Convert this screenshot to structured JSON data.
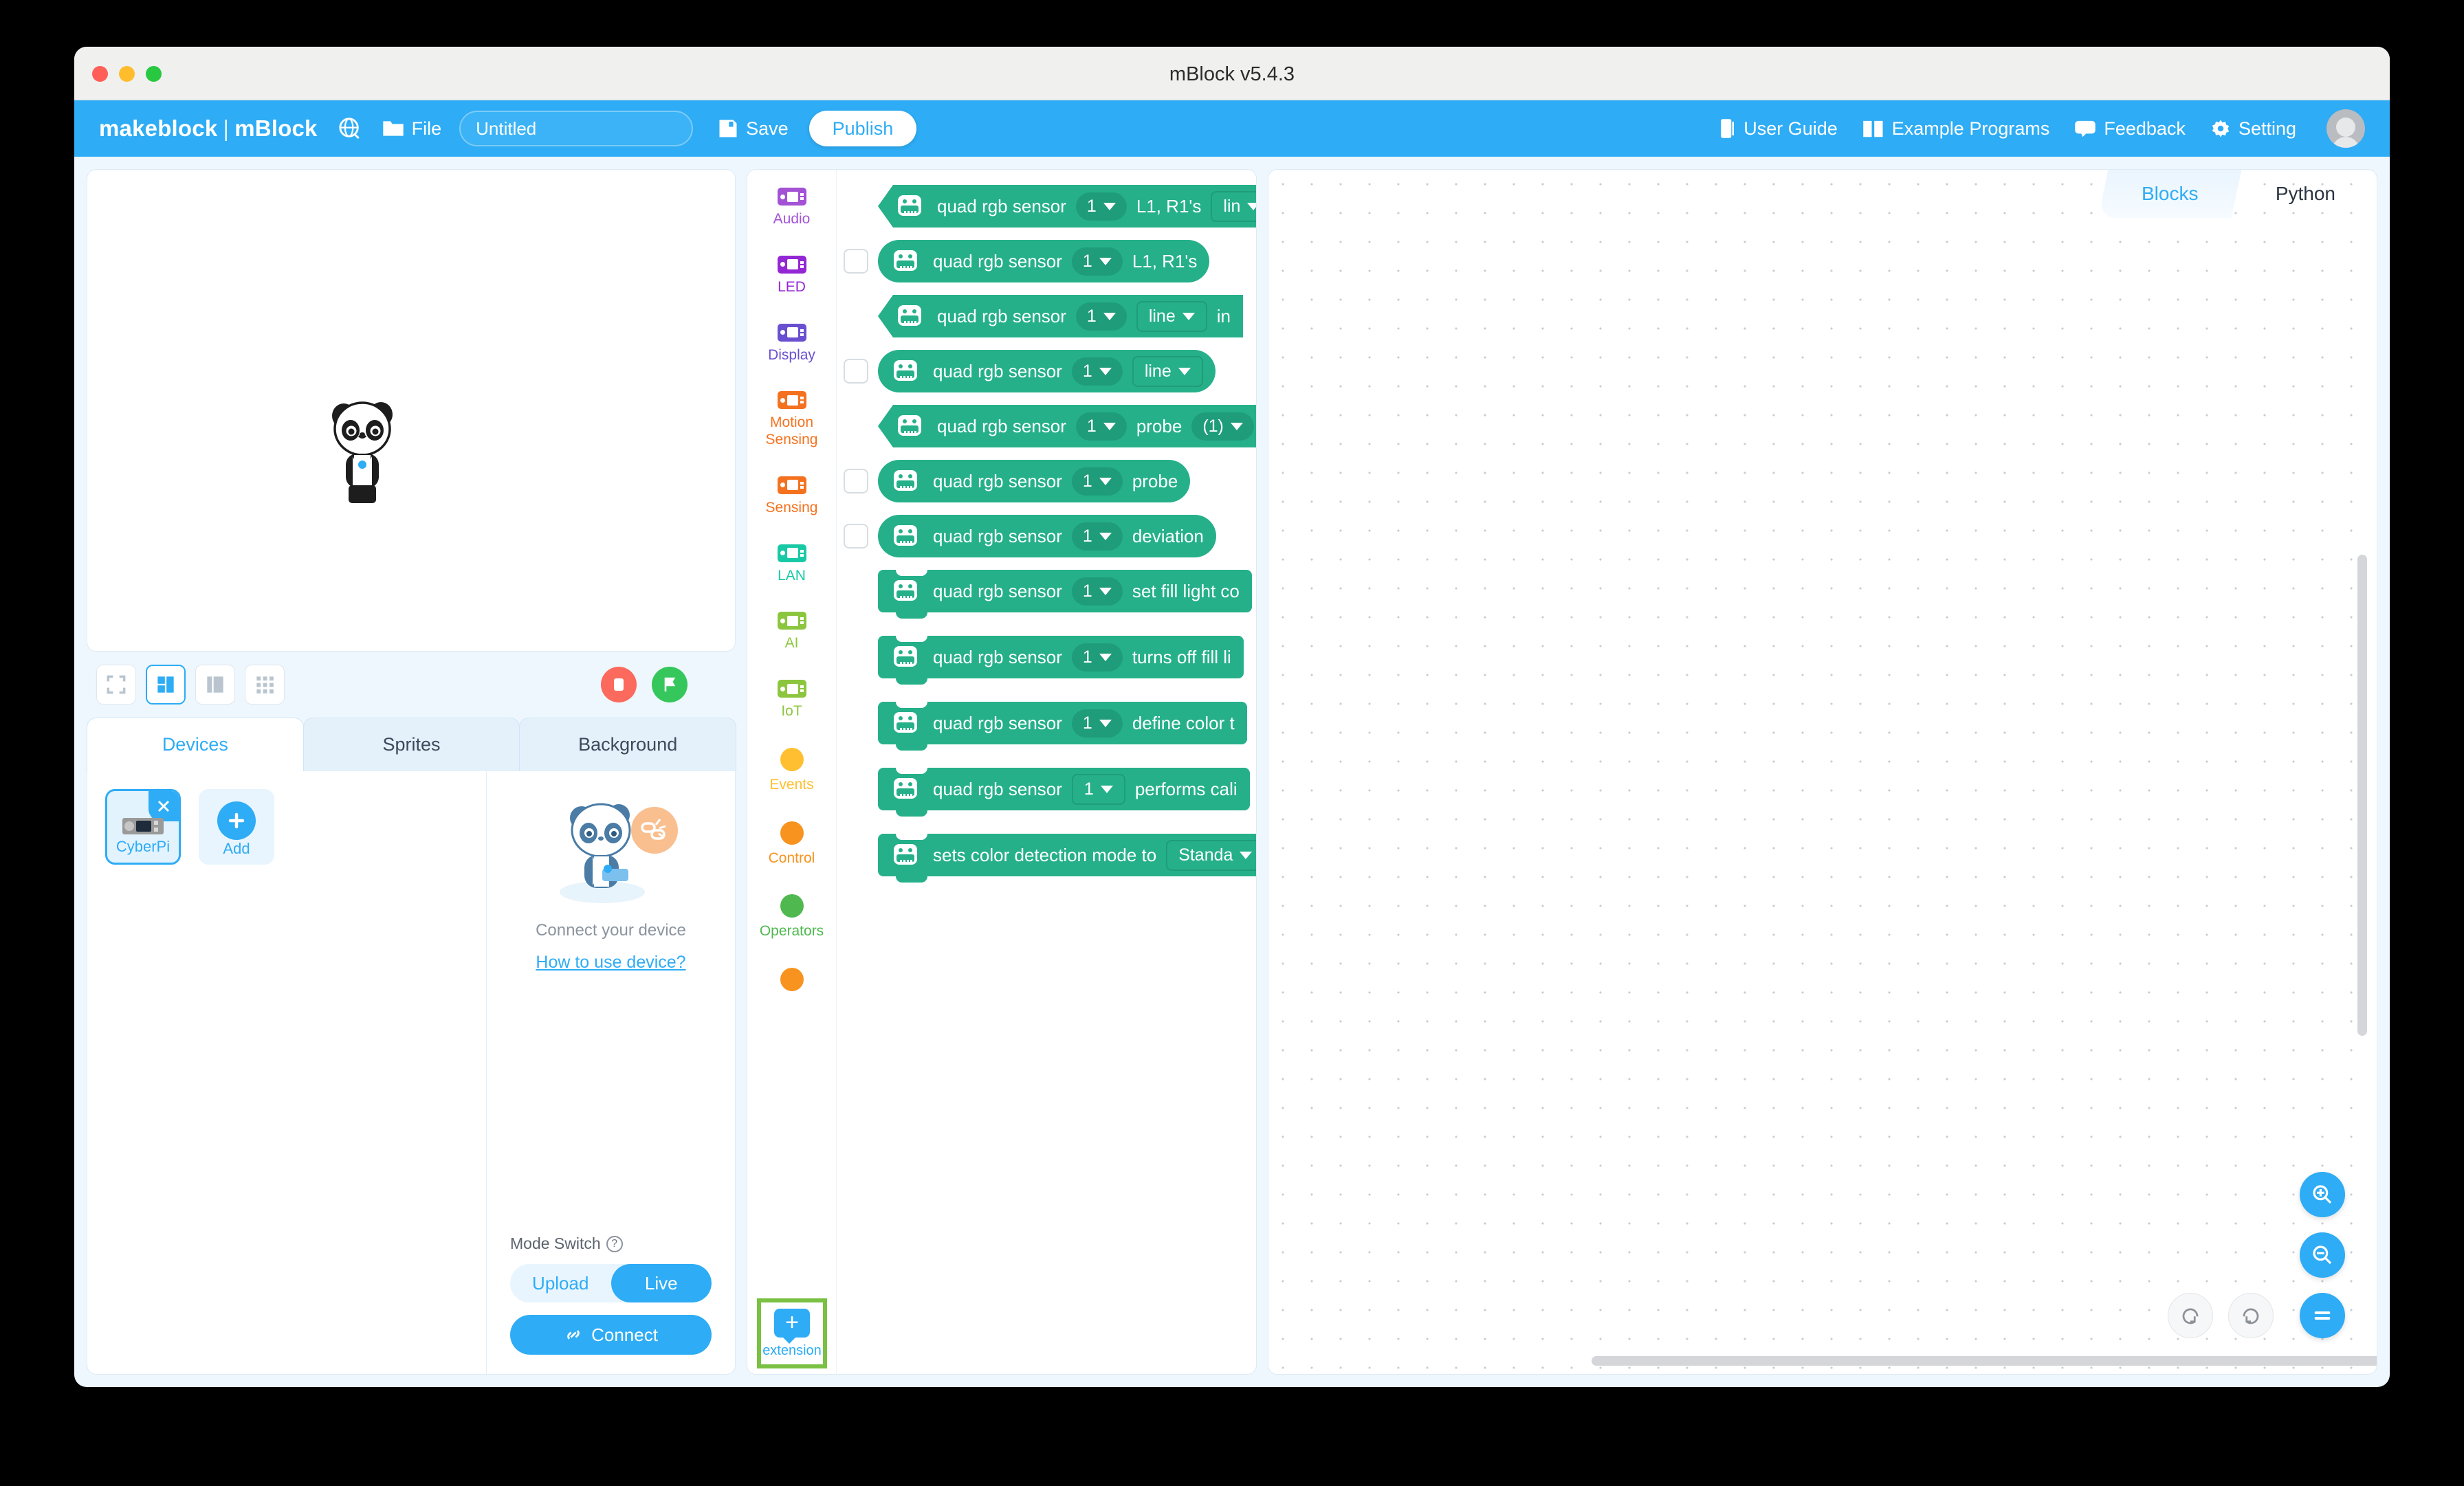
{
  "window": {
    "title": "mBlock v5.4.3"
  },
  "toolbar": {
    "brand_make": "makeblock",
    "brand_sep": "|",
    "brand_mblock": "mBlock",
    "globe_icon": "globe-icon",
    "file_label": "File",
    "project_name": "Untitled",
    "project_placeholder": "Untitled",
    "save_label": "Save",
    "publish_label": "Publish",
    "right_items": [
      {
        "label": "User Guide",
        "icon": "book-icon"
      },
      {
        "label": "Example Programs",
        "icon": "open-book-icon"
      },
      {
        "label": "Feedback",
        "icon": "chat-icon"
      },
      {
        "label": "Setting",
        "icon": "gear-icon"
      }
    ]
  },
  "stage": {
    "view_buttons": [
      "fullscreen-view",
      "small-stage-view",
      "large-stage-view",
      "grid-view"
    ],
    "selected_view": "small-stage-view",
    "stop_label": "stop-button",
    "go_label": "green-flag-button"
  },
  "tabs": [
    {
      "label": "Devices",
      "active": true
    },
    {
      "label": "Sprites",
      "active": false
    },
    {
      "label": "Background",
      "active": false
    }
  ],
  "devices": {
    "items": [
      {
        "label": "CyberPi",
        "selected": true
      },
      {
        "label": "Add",
        "selected": false
      }
    ],
    "close_glyph": "✕",
    "add_glyph": "+"
  },
  "connect": {
    "message": "Connect your device",
    "link": "How to use device?",
    "mode_label": "Mode Switch",
    "help_glyph": "?",
    "modes": [
      "Upload",
      "Live"
    ],
    "active_mode": "Live",
    "connect_label": "Connect",
    "connect_icon": "link-icon"
  },
  "palette": {
    "categories": [
      {
        "label": "Audio",
        "color": "#a352d6",
        "shape": "chip"
      },
      {
        "label": "LED",
        "color": "#9327d4",
        "shape": "chip"
      },
      {
        "label": "Display",
        "color": "#6a4fd0",
        "shape": "chip"
      },
      {
        "label": "Motion\nSensing",
        "color": "#f4721f",
        "shape": "chip"
      },
      {
        "label": "Sensing",
        "color": "#f4721f",
        "shape": "chip"
      },
      {
        "label": "LAN",
        "color": "#19c9a6",
        "shape": "chip"
      },
      {
        "label": "AI",
        "color": "#8cc63e",
        "shape": "chip"
      },
      {
        "label": "IoT",
        "color": "#8cc63e",
        "shape": "chip"
      },
      {
        "label": "Events",
        "color": "#ffbf30",
        "shape": "ball"
      },
      {
        "label": "Control",
        "color": "#f7931e",
        "shape": "ball"
      },
      {
        "label": "Operators",
        "color": "#4fb94f",
        "shape": "ball"
      },
      {
        "label": "",
        "color": "#f7931e",
        "shape": "ball"
      }
    ],
    "extension": {
      "label": "extension",
      "glyph": "+",
      "highlight_color": "#7ac143"
    },
    "blocks": [
      {
        "kind": "bool",
        "checkbox": false,
        "icon": "quad-rgb-sensor-icon",
        "parts": [
          {
            "t": "text",
            "v": "quad rgb sensor"
          },
          {
            "t": "dd",
            "v": "1"
          },
          {
            "t": "text",
            "v": "L1, R1's"
          },
          {
            "t": "ddsq",
            "v": "lin"
          }
        ]
      },
      {
        "kind": "round",
        "checkbox": true,
        "icon": "quad-rgb-sensor-icon",
        "parts": [
          {
            "t": "text",
            "v": "quad rgb sensor"
          },
          {
            "t": "dd",
            "v": "1"
          },
          {
            "t": "text",
            "v": "L1, R1's"
          }
        ]
      },
      {
        "kind": "bool",
        "checkbox": false,
        "icon": "quad-rgb-sensor-icon",
        "parts": [
          {
            "t": "text",
            "v": "quad rgb sensor"
          },
          {
            "t": "dd",
            "v": "1"
          },
          {
            "t": "ddsq",
            "v": "line"
          },
          {
            "t": "text",
            "v": "in"
          }
        ]
      },
      {
        "kind": "round",
        "checkbox": true,
        "icon": "quad-rgb-sensor-icon",
        "parts": [
          {
            "t": "text",
            "v": "quad rgb sensor"
          },
          {
            "t": "dd",
            "v": "1"
          },
          {
            "t": "ddsq",
            "v": "line"
          }
        ]
      },
      {
        "kind": "bool",
        "checkbox": false,
        "icon": "quad-rgb-sensor-icon",
        "parts": [
          {
            "t": "text",
            "v": "quad rgb sensor"
          },
          {
            "t": "dd",
            "v": "1"
          },
          {
            "t": "text",
            "v": "probe"
          },
          {
            "t": "dd",
            "v": "(1)"
          }
        ]
      },
      {
        "kind": "round",
        "checkbox": true,
        "icon": "quad-rgb-sensor-icon",
        "parts": [
          {
            "t": "text",
            "v": "quad rgb sensor"
          },
          {
            "t": "dd",
            "v": "1"
          },
          {
            "t": "text",
            "v": "probe"
          }
        ]
      },
      {
        "kind": "round",
        "checkbox": true,
        "icon": "quad-rgb-sensor-icon",
        "parts": [
          {
            "t": "text",
            "v": "quad rgb sensor"
          },
          {
            "t": "dd",
            "v": "1"
          },
          {
            "t": "text",
            "v": "deviation"
          }
        ]
      },
      {
        "kind": "stack",
        "checkbox": false,
        "icon": "quad-rgb-sensor-icon",
        "parts": [
          {
            "t": "text",
            "v": "quad rgb sensor"
          },
          {
            "t": "dd",
            "v": "1"
          },
          {
            "t": "text",
            "v": "set fill light co"
          }
        ]
      },
      {
        "kind": "stack",
        "checkbox": false,
        "icon": "quad-rgb-sensor-icon",
        "parts": [
          {
            "t": "text",
            "v": "quad rgb sensor"
          },
          {
            "t": "dd",
            "v": "1"
          },
          {
            "t": "text",
            "v": "turns off fill li"
          }
        ]
      },
      {
        "kind": "stack",
        "checkbox": false,
        "icon": "quad-rgb-sensor-icon",
        "parts": [
          {
            "t": "text",
            "v": "quad rgb sensor"
          },
          {
            "t": "dd",
            "v": "1"
          },
          {
            "t": "text",
            "v": "define color t"
          }
        ]
      },
      {
        "kind": "stack",
        "checkbox": false,
        "icon": "quad-rgb-sensor-icon",
        "parts": [
          {
            "t": "text",
            "v": "quad rgb sensor"
          },
          {
            "t": "ddsq",
            "v": "1"
          },
          {
            "t": "text",
            "v": "performs cali"
          }
        ]
      },
      {
        "kind": "stack",
        "checkbox": false,
        "icon": "quad-rgb-sensor-icon",
        "parts": [
          {
            "t": "text",
            "v": "sets color detection mode to"
          },
          {
            "t": "ddsq",
            "v": "Standa"
          }
        ]
      }
    ]
  },
  "code": {
    "tabs": [
      {
        "label": "Blocks",
        "active": true
      },
      {
        "label": "Python",
        "active": false
      }
    ],
    "fabs": [
      "zoom-in-button",
      "zoom-out-button",
      "zoom-reset-button"
    ],
    "history": [
      "undo-button",
      "redo-button"
    ]
  }
}
